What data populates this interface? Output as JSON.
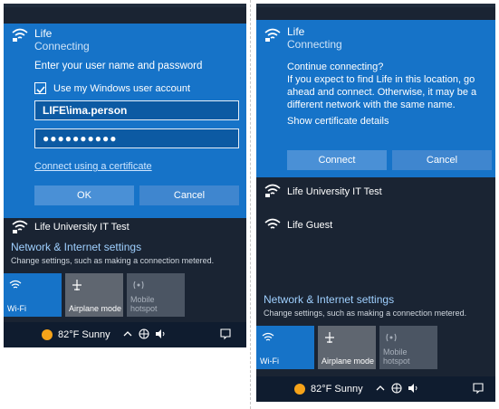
{
  "left": {
    "network": {
      "name": "Life",
      "status": "Connecting"
    },
    "prompt": "Enter your user name and password",
    "checkbox_label": "Use my Windows user account",
    "username_value": "LIFE\\ima.person",
    "password_value": "●●●●●●●●●●",
    "cert_link": "Connect using a certificate",
    "ok_label": "OK",
    "cancel_label": "Cancel",
    "other_networks": [
      "Life University IT Test"
    ],
    "settings_title": "Network & Internet settings",
    "settings_sub": "Change settings, such as making a connection metered.",
    "tiles": [
      {
        "label": "Wi-Fi",
        "icon": "wifi-icon"
      },
      {
        "label": "Airplane mode",
        "icon": "airplane-icon"
      },
      {
        "label": "Mobile\nhotspot",
        "icon": "hotspot-icon"
      }
    ],
    "taskbar": {
      "weather": "82°F  Sunny"
    }
  },
  "right": {
    "network": {
      "name": "Life",
      "status": "Connecting"
    },
    "message_1": "Continue connecting?",
    "message_2": "If you expect to find Life in this location, go ahead and connect. Otherwise, it may be a different network with the same name.",
    "message_3": "Show certificate details",
    "connect_label": "Connect",
    "cancel_label": "Cancel",
    "other_networks": [
      "Life University IT Test",
      "Life Guest"
    ],
    "settings_title": "Network & Internet settings",
    "settings_sub": "Change settings, such as making a connection metered.",
    "tiles": [
      {
        "label": "Wi-Fi",
        "icon": "wifi-icon"
      },
      {
        "label": "Airplane mode",
        "icon": "airplane-icon"
      },
      {
        "label": "Mobile\nhotspot",
        "icon": "hotspot-icon"
      }
    ],
    "taskbar": {
      "weather": "82°F  Sunny"
    }
  },
  "colors": {
    "accent": "#1673c8",
    "panel": "#1a2433",
    "taskbar": "#0f1c2f",
    "link": "#9fd0ff"
  }
}
